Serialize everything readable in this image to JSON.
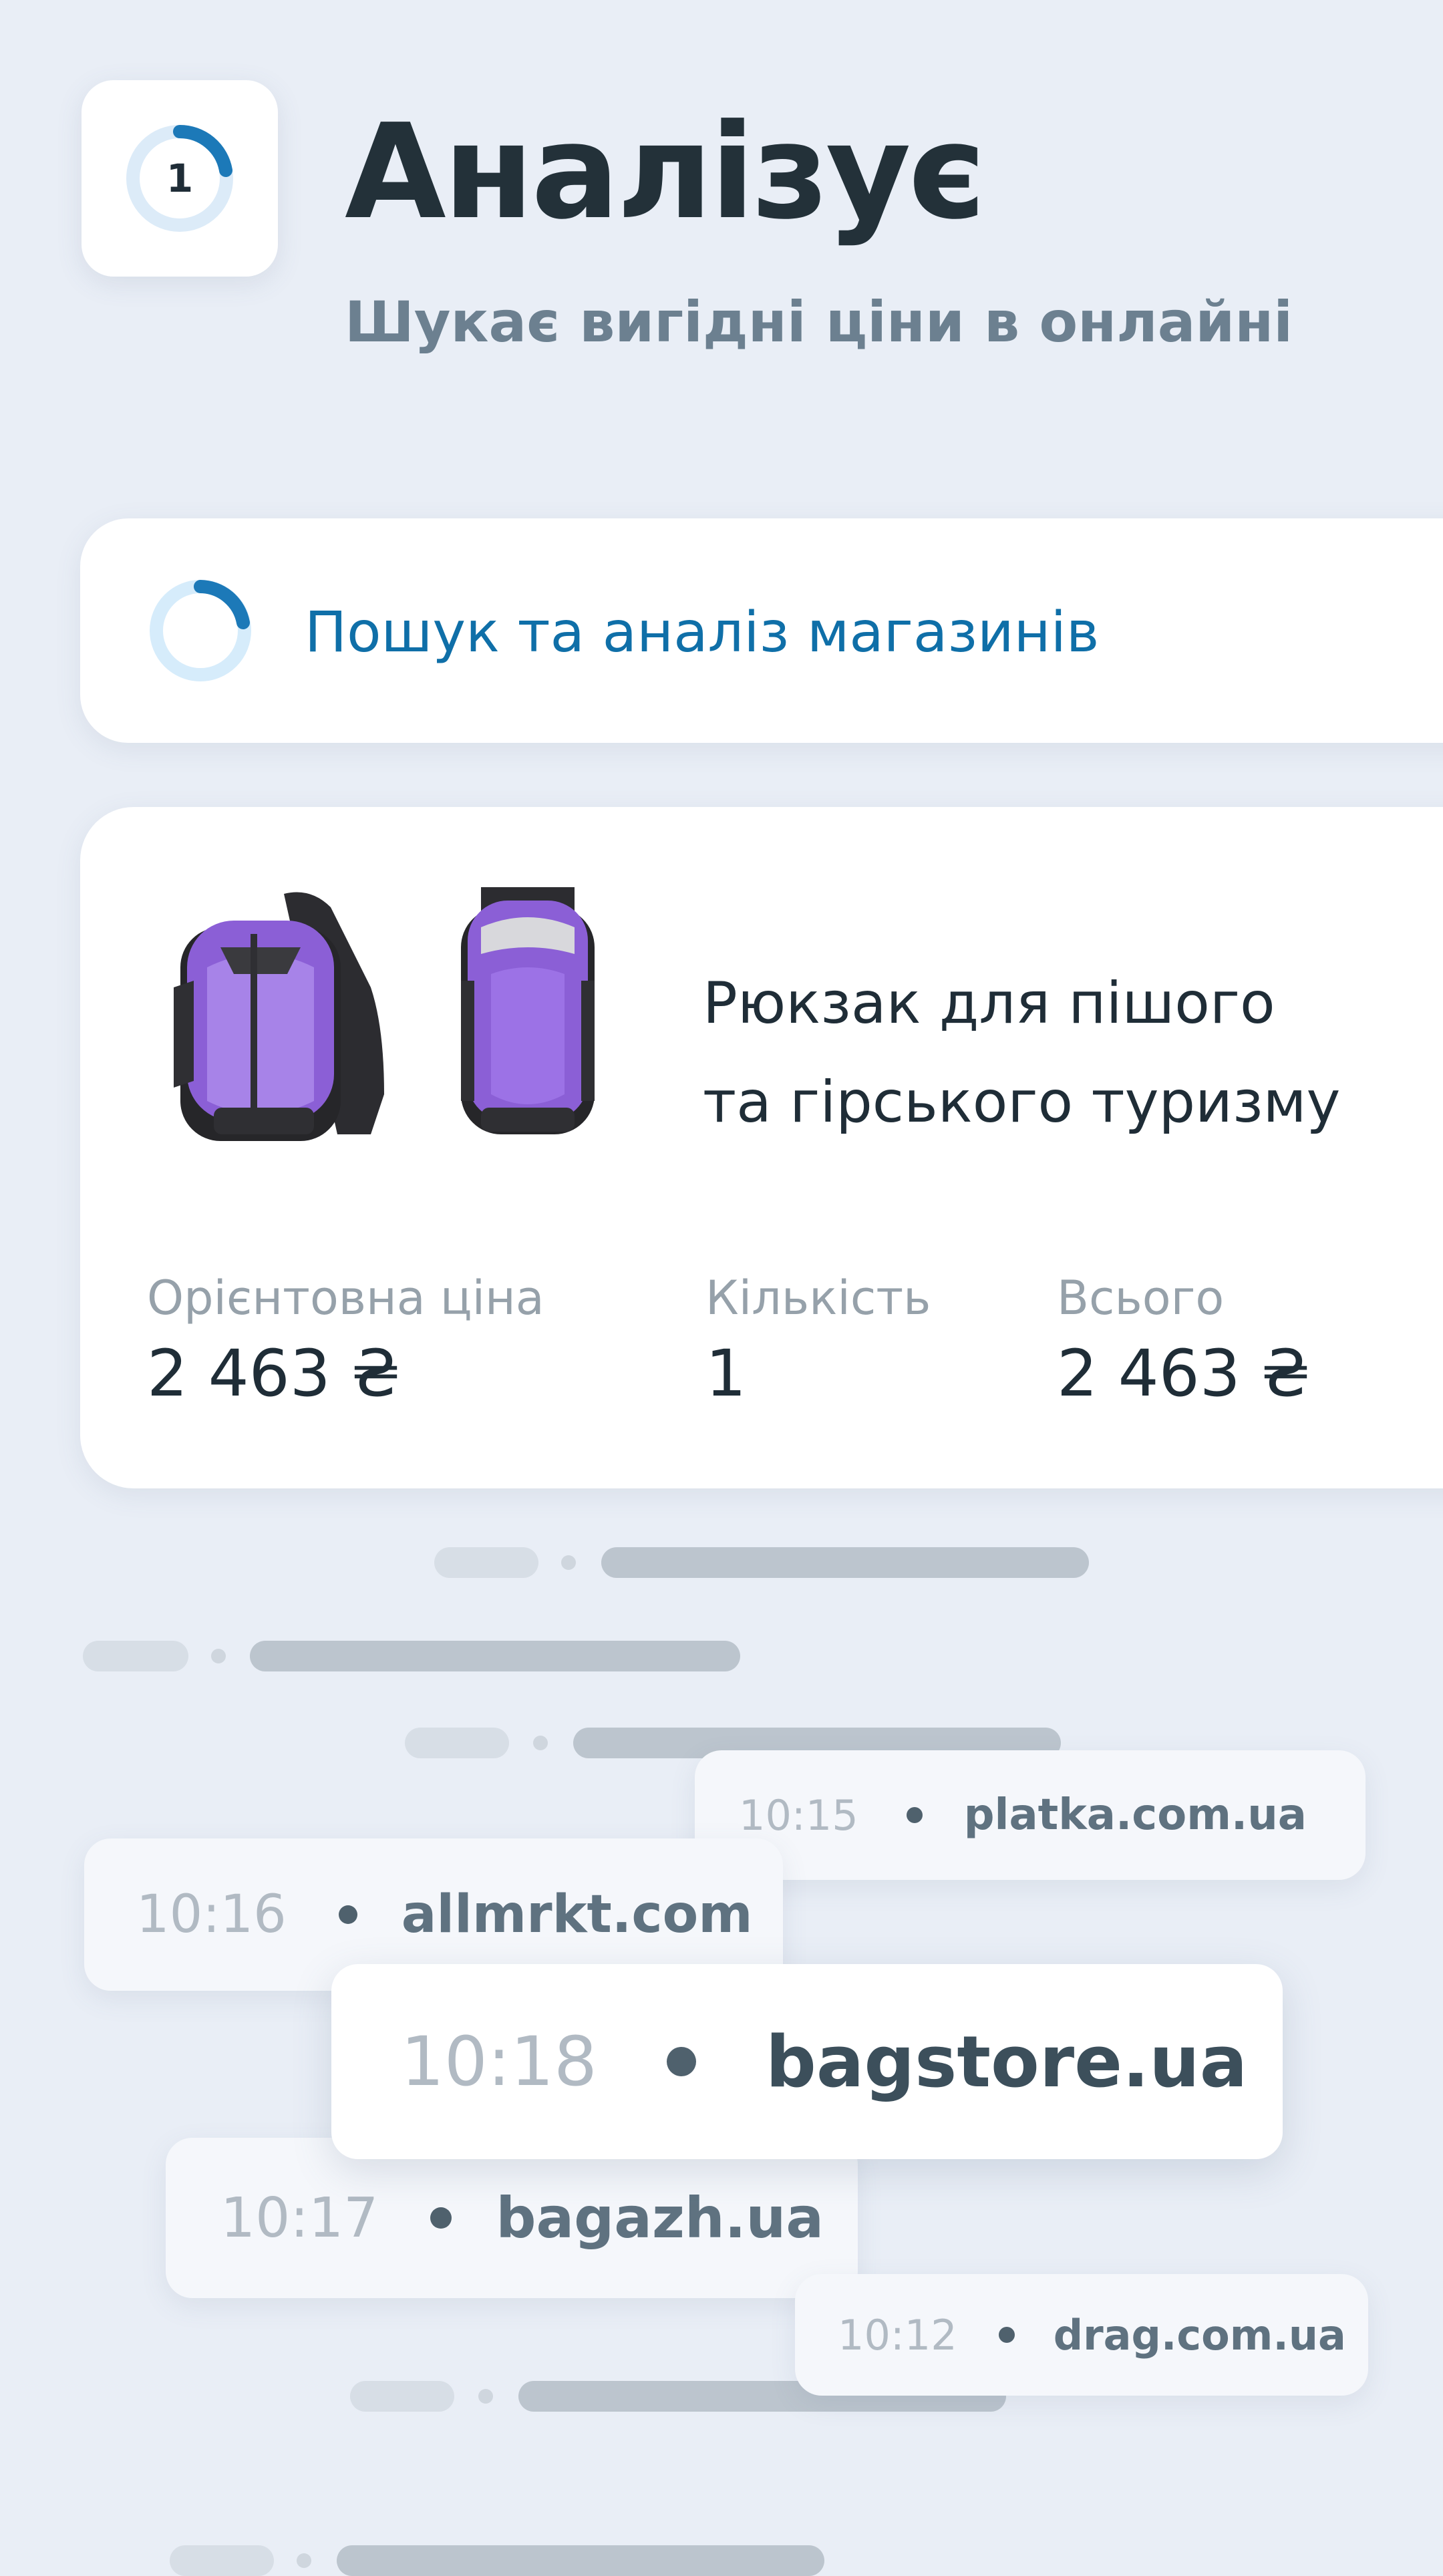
{
  "header": {
    "step_number": "1",
    "title": "Аналізує",
    "subtitle": "Шукає вигідні ціни в онлайні"
  },
  "status": {
    "text": "Пошук та аналіз магазинів"
  },
  "product": {
    "name_line1": "Рюкзак для пішого",
    "name_line2": "та гірського туризму",
    "price_label": "Орієнтовна ціна",
    "price_value": "2 463 ₴",
    "qty_label": "Кількість",
    "qty_value": "1",
    "total_label": "Всього",
    "total_value": "2 463 ₴",
    "image_icon": "backpack-image"
  },
  "log": [
    {
      "time": "10:15",
      "site": "platka.com.ua"
    },
    {
      "time": "10:16",
      "site": "allmrkt.com"
    },
    {
      "time": "10:18",
      "site": "bagstore.ua"
    },
    {
      "time": "10:17",
      "site": "bagazh.ua"
    },
    {
      "time": "10:12",
      "site": "drag.com.ua"
    }
  ],
  "colors": {
    "accent": "#0f6fa8",
    "background": "#e9eef6",
    "backpack": "#8b5fd6"
  }
}
